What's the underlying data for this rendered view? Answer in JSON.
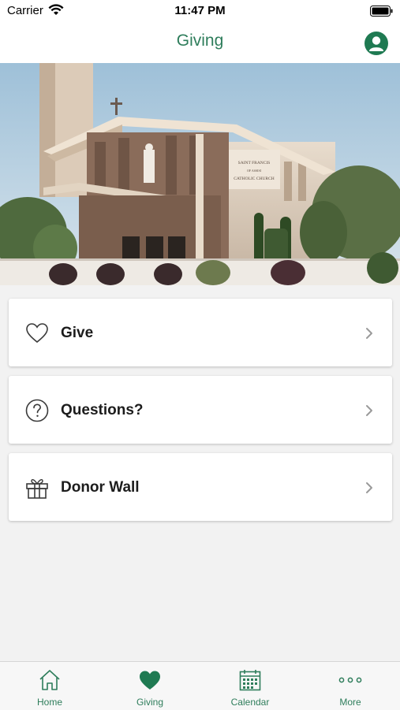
{
  "status_bar": {
    "carrier": "Carrier",
    "time": "11:47 PM"
  },
  "nav": {
    "title": "Giving"
  },
  "menu": [
    {
      "label": "Give",
      "icon": "heart-outline-icon"
    },
    {
      "label": "Questions?",
      "icon": "question-circle-icon"
    },
    {
      "label": "Donor Wall",
      "icon": "gift-icon"
    }
  ],
  "tabs": [
    {
      "label": "Home",
      "icon": "home-icon",
      "active": false
    },
    {
      "label": "Giving",
      "icon": "heart-filled-icon",
      "active": true
    },
    {
      "label": "Calendar",
      "icon": "calendar-icon",
      "active": false
    },
    {
      "label": "More",
      "icon": "more-dots-icon",
      "active": false
    }
  ],
  "hero": {
    "sign_text": "SAINT FRANCIS OF ASSISI CATHOLIC CHURCH"
  },
  "colors": {
    "accent": "#1f7a52",
    "accent_text": "#2e7d5b",
    "background": "#f2f2f2"
  }
}
